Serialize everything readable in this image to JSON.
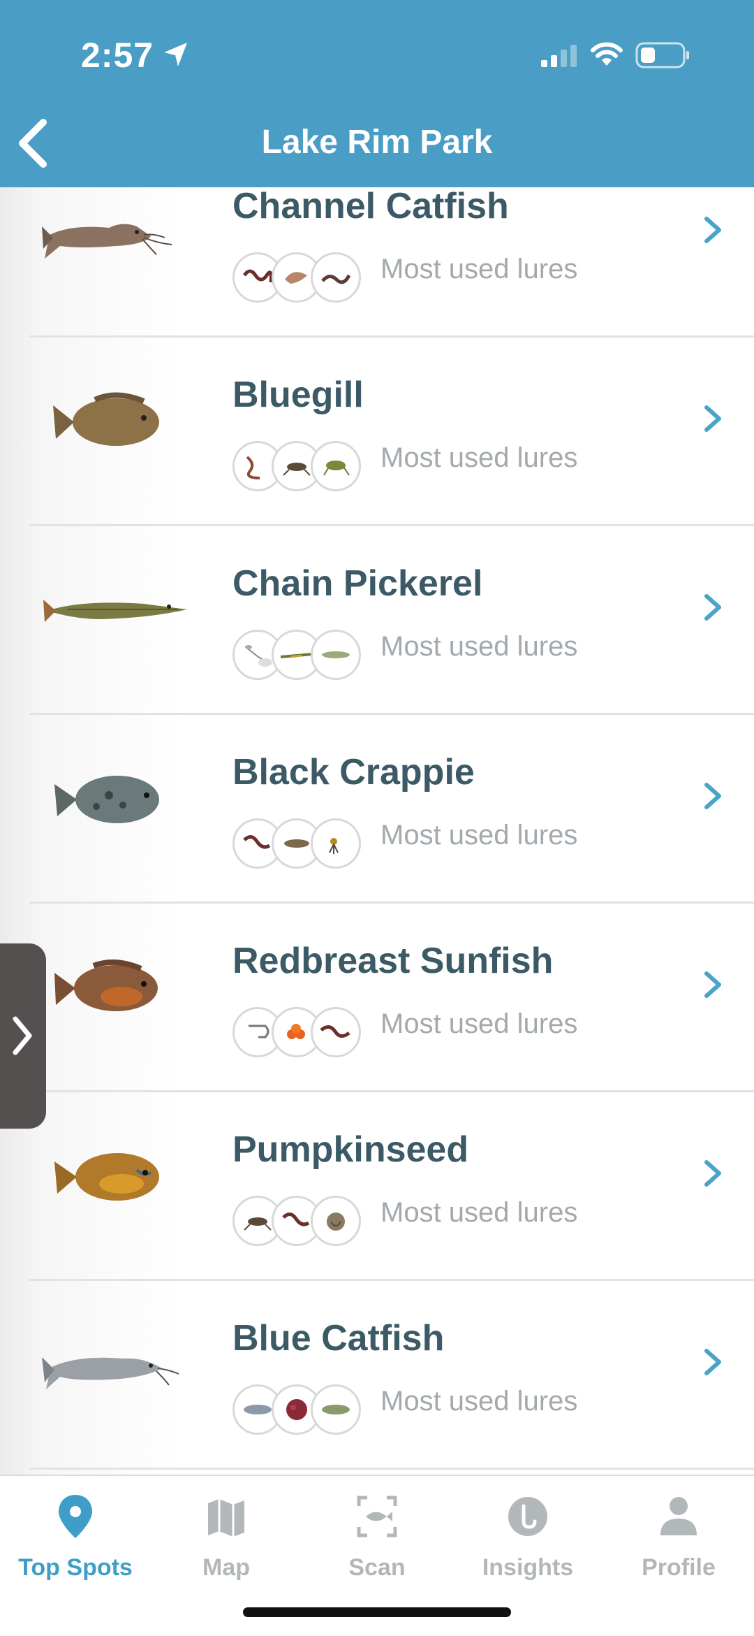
{
  "status_bar": {
    "time": "2:57"
  },
  "header": {
    "title": "Lake Rim Park"
  },
  "fish_list": [
    {
      "name": "Channel Catfish",
      "caption": "Most used lures",
      "lures": [
        "worm",
        "shrimp",
        "worm"
      ]
    },
    {
      "name": "Bluegill",
      "caption": "Most used lures",
      "lures": [
        "worm",
        "cricket",
        "grasshopper"
      ]
    },
    {
      "name": "Chain Pickerel",
      "caption": "Most used lures",
      "lures": [
        "spinnerbait",
        "minnow-lure",
        "minnow-lure"
      ]
    },
    {
      "name": "Black Crappie",
      "caption": "Most used lures",
      "lures": [
        "worm",
        "minnow",
        "jig"
      ]
    },
    {
      "name": "Redbreast Sunfish",
      "caption": "Most used lures",
      "lures": [
        "hook",
        "salmon-eggs",
        "worm"
      ]
    },
    {
      "name": "Pumpkinseed",
      "caption": "Most used lures",
      "lures": [
        "cricket",
        "worm",
        "snail"
      ]
    },
    {
      "name": "Blue Catfish",
      "caption": "Most used lures",
      "lures": [
        "shad",
        "chicken-liver",
        "shad"
      ]
    }
  ],
  "tabs": [
    {
      "label": "Top Spots",
      "icon": "map-pin-icon",
      "active": true
    },
    {
      "label": "Map",
      "icon": "folded-map-icon",
      "active": false
    },
    {
      "label": "Scan",
      "icon": "scan-fish-icon",
      "active": false
    },
    {
      "label": "Insights",
      "icon": "insights-icon",
      "active": false
    },
    {
      "label": "Profile",
      "icon": "person-icon",
      "active": false
    }
  ],
  "colors": {
    "header_bg": "#4a9dc4",
    "fish_name": "#3c5a66",
    "caption": "#a3a9ad",
    "chevron": "#4aa3c9",
    "tab_active": "#3f9ec8",
    "tab_inactive": "#b2b7ba"
  }
}
